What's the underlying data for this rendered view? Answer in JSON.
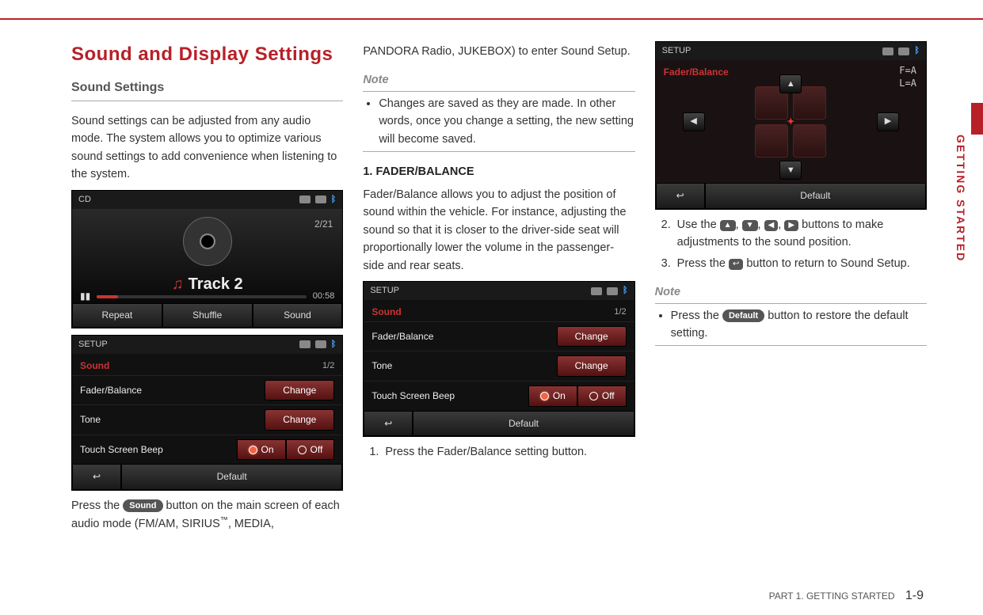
{
  "sideTab": "GETTING STARTED",
  "h1": "Sound and Display Settings",
  "h2": "Sound Settings",
  "intro": "Sound settings can be adjusted from any audio mode. The system allows you to optimize various sound settings to add convenience when listening to the system.",
  "pressSound1": "Press the ",
  "chipSound": "Sound",
  "pressSound2": " button on the main screen of each audio mode (FM/AM, SIRIUS",
  "tm": "™",
  "pressSound3": ", MEDIA,",
  "cd": {
    "title": "CD",
    "count": "2/21",
    "track": "Track 2",
    "time": "00:58",
    "repeat": "Repeat",
    "shuffle": "Shuffle",
    "sound": "Sound"
  },
  "setup": {
    "title": "SETUP",
    "section": "Sound",
    "page": "1/2",
    "row1": "Fader/Balance",
    "row2": "Tone",
    "row3": "Touch Screen Beep",
    "change": "Change",
    "on": "On",
    "off": "Off",
    "default": "Default",
    "back": "↩"
  },
  "col2Top": "PANDORA Radio, JUKEBOX) to enter Sound Setup.",
  "note": "Note",
  "noteItem1": "Changes are saved as they are made. In other words, once you change a setting, the new setting will become saved.",
  "sec1Title": "1. FADER/BALANCE",
  "sec1Body": "Fader/Balance allows you to adjust the position of sound within the vehicle. For instance, adjusting the sound so that it is closer to the driver-side seat will proportionally lower the volume in the passenger-side and rear seats.",
  "step1": "Press the Fader/Balance setting button.",
  "fader": {
    "title": "SETUP",
    "section": "Fader/Balance",
    "fa": "F=A",
    "la": "L=A"
  },
  "step2a": "Use the ",
  "step2b": " buttons to make adjustments to the sound position.",
  "step3a": "Press the ",
  "step3b": " button to return to Sound Setup.",
  "note2a": "Press the ",
  "chipDefault": "Default",
  "note2b": " button to restore the default setting.",
  "footerPart": "PART 1. GETTING STARTED",
  "footerPage": "1-9"
}
